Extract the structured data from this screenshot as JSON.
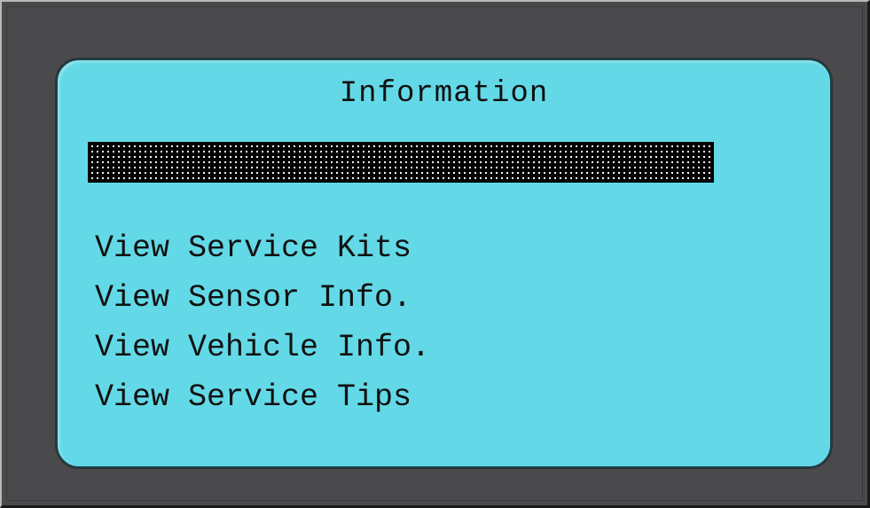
{
  "screen": {
    "title": "Information",
    "selected_index": 0,
    "menu_items": [
      {
        "label": "View Service Kits"
      },
      {
        "label": "View Sensor Info."
      },
      {
        "label": "View Vehicle Info."
      },
      {
        "label": "View Service Tips"
      }
    ]
  },
  "colors": {
    "lcd_background": "#63d9e7",
    "bezel": "#4a4a4c",
    "text": "#111111"
  }
}
